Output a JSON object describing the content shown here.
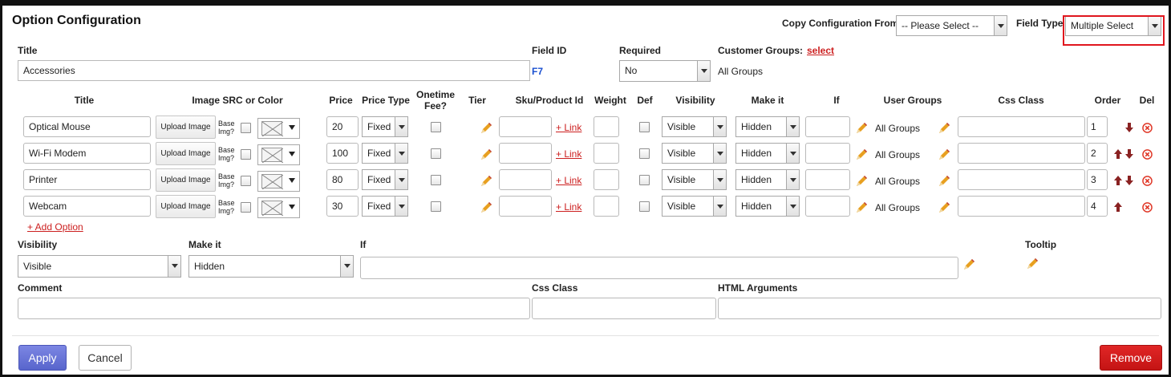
{
  "header": {
    "title": "Option Configuration",
    "copy_label": "Copy Configuration From:",
    "copy_value": "-- Please Select --",
    "field_type_label": "Field Type",
    "field_type_value": "Multiple Select"
  },
  "top": {
    "title_label": "Title",
    "title_value": "Accessories",
    "field_id_label": "Field ID",
    "field_id_value": "F7",
    "required_label": "Required",
    "required_value": "No",
    "customer_groups_label": "Customer Groups:",
    "customer_groups_link": "select",
    "customer_groups_value": "All Groups"
  },
  "columns": {
    "title": "Title",
    "image": "Image SRC or Color",
    "price": "Price",
    "price_type": "Price Type",
    "onetime_1": "Onetime",
    "onetime_2": "Fee?",
    "tier": "Tier",
    "sku": "Sku/Product Id",
    "weight": "Weight",
    "def": "Def",
    "visibility": "Visibility",
    "make_it": "Make it",
    "if": "If",
    "user_groups": "User Groups",
    "css_class": "Css Class",
    "order": "Order",
    "del": "Del"
  },
  "row_labels": {
    "upload": "Upload Image",
    "base_1": "Base",
    "base_2": "Img?",
    "link": "+ Link"
  },
  "options": [
    {
      "title": "Optical Mouse",
      "price": "20",
      "price_type": "Fixed",
      "visibility": "Visible",
      "make_it": "Hidden",
      "user_groups": "All Groups",
      "order": "1"
    },
    {
      "title": "Wi-Fi Modem",
      "price": "100",
      "price_type": "Fixed",
      "visibility": "Visible",
      "make_it": "Hidden",
      "user_groups": "All Groups",
      "order": "2"
    },
    {
      "title": "Printer",
      "price": "80",
      "price_type": "Fixed",
      "visibility": "Visible",
      "make_it": "Hidden",
      "user_groups": "All Groups",
      "order": "3"
    },
    {
      "title": "Webcam",
      "price": "30",
      "price_type": "Fixed",
      "visibility": "Visible",
      "make_it": "Hidden",
      "user_groups": "All Groups",
      "order": "4"
    }
  ],
  "add_option": "+ Add Option",
  "bottom": {
    "visibility_label": "Visibility",
    "visibility_value": "Visible",
    "make_it_label": "Make it",
    "make_it_value": "Hidden",
    "if_label": "If",
    "tooltip_label": "Tooltip",
    "comment_label": "Comment",
    "css_class_label": "Css Class",
    "html_args_label": "HTML Arguments"
  },
  "actions": {
    "apply": "Apply",
    "cancel": "Cancel",
    "remove": "Remove"
  },
  "colors": {
    "link_red": "#cc1f1f",
    "field_id_blue": "#1a4fd0",
    "apply_blue": "#5865cc",
    "remove_red": "#c41414",
    "highlight_red": "#e0161e"
  }
}
